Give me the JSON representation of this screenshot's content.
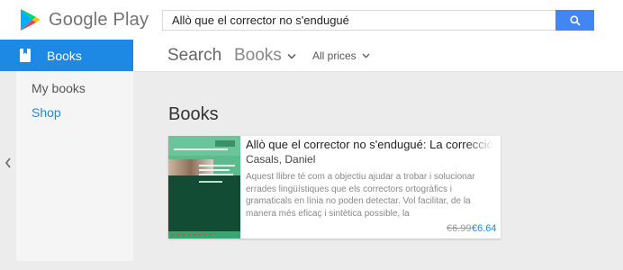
{
  "header": {
    "logo_text": "Google Play",
    "search": {
      "value": "Allò que el corrector no s'endugué",
      "placeholder": ""
    },
    "search_icon": "search-icon"
  },
  "sidebar": {
    "active_section": {
      "label": "Books",
      "icon": "book-icon"
    },
    "items": [
      {
        "label": "My books"
      },
      {
        "label": "Shop"
      }
    ],
    "collapse_icon": "chevron-left-icon",
    "accent_color": "#1e88e5"
  },
  "topnav": {
    "search_label": "Search",
    "category_label": "Books",
    "price_filter_label": "All prices"
  },
  "main": {
    "section_title": "Books",
    "results": [
      {
        "title": "Allò que el corrector no s'endugué: La correcció postorrectora",
        "author": "Casals, Daniel",
        "description": "Aquest llibre té com a objectiu ajudar a trobar i solucionar errades lingüístiques que els correctors ortogràfics i gramaticals en línia no poden detectar. Vol facilitar, de la manera més eficaç i sintètica possible, la",
        "price_original": "€6.99",
        "price_current": "€6.64"
      }
    ]
  }
}
